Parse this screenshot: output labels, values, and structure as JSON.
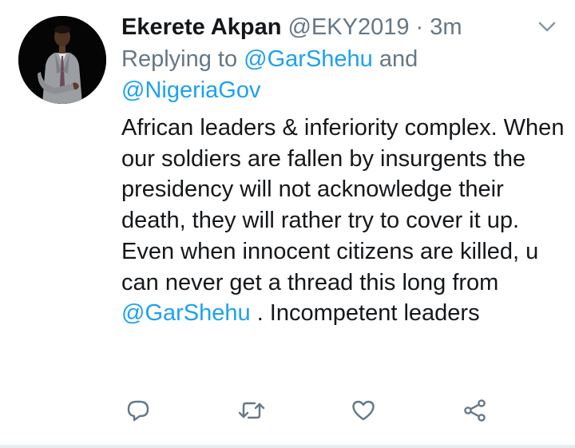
{
  "tweet": {
    "display_name": "Ekerete Akpan",
    "handle": "@EKY2019",
    "separator": "·",
    "time": "3m",
    "replying_prefix": "Replying to ",
    "replying_mention_1": "@GarShehu",
    "replying_joiner": " and",
    "replying_mention_2": "@NigeriaGov",
    "text_before_mention": "African leaders & inferiority complex. When our soldiers are fallen by insurgents the presidency will not acknowledge their death, they will rather try to cover it up. Even when innocent citizens are killed, u can never get a thread this long from ",
    "text_mention": "@GarShehu",
    "text_after_mention": " . Incompetent leaders"
  },
  "actions": {
    "reply_icon": "comment-icon",
    "retweet_icon": "retweet-icon",
    "like_icon": "heart-icon",
    "share_icon": "share-icon"
  },
  "colors": {
    "link": "#1da1f2",
    "secondary_text": "#657786",
    "primary_text": "#14171a",
    "divider": "#e6ecf0"
  }
}
